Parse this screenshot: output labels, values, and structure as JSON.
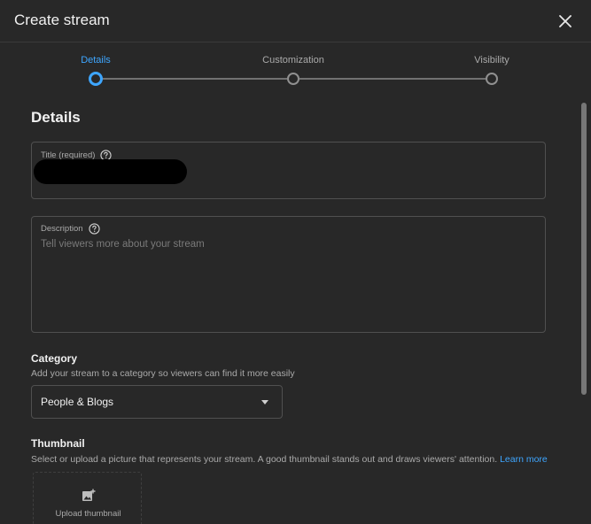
{
  "dialog": {
    "title": "Create stream",
    "close_icon": "close-icon"
  },
  "stepper": {
    "steps": [
      {
        "label": "Details",
        "active": true
      },
      {
        "label": "Customization",
        "active": false
      },
      {
        "label": "Visibility",
        "active": false
      }
    ]
  },
  "details": {
    "heading": "Details",
    "title_field": {
      "label": "Title (required)",
      "value": ""
    },
    "description_field": {
      "label": "Description",
      "placeholder": "Tell viewers more about your stream"
    }
  },
  "category": {
    "heading": "Category",
    "subtitle": "Add your stream to a category so viewers can find it more easily",
    "selected": "People & Blogs"
  },
  "thumbnail": {
    "heading": "Thumbnail",
    "subtitle": "Select or upload a picture that represents your stream. A good thumbnail stands out and draws viewers' attention.",
    "learn_more": "Learn more",
    "upload_label": "Upload thumbnail"
  },
  "colors": {
    "accent": "#3ea6ff",
    "background": "#282828",
    "border": "#505050"
  }
}
